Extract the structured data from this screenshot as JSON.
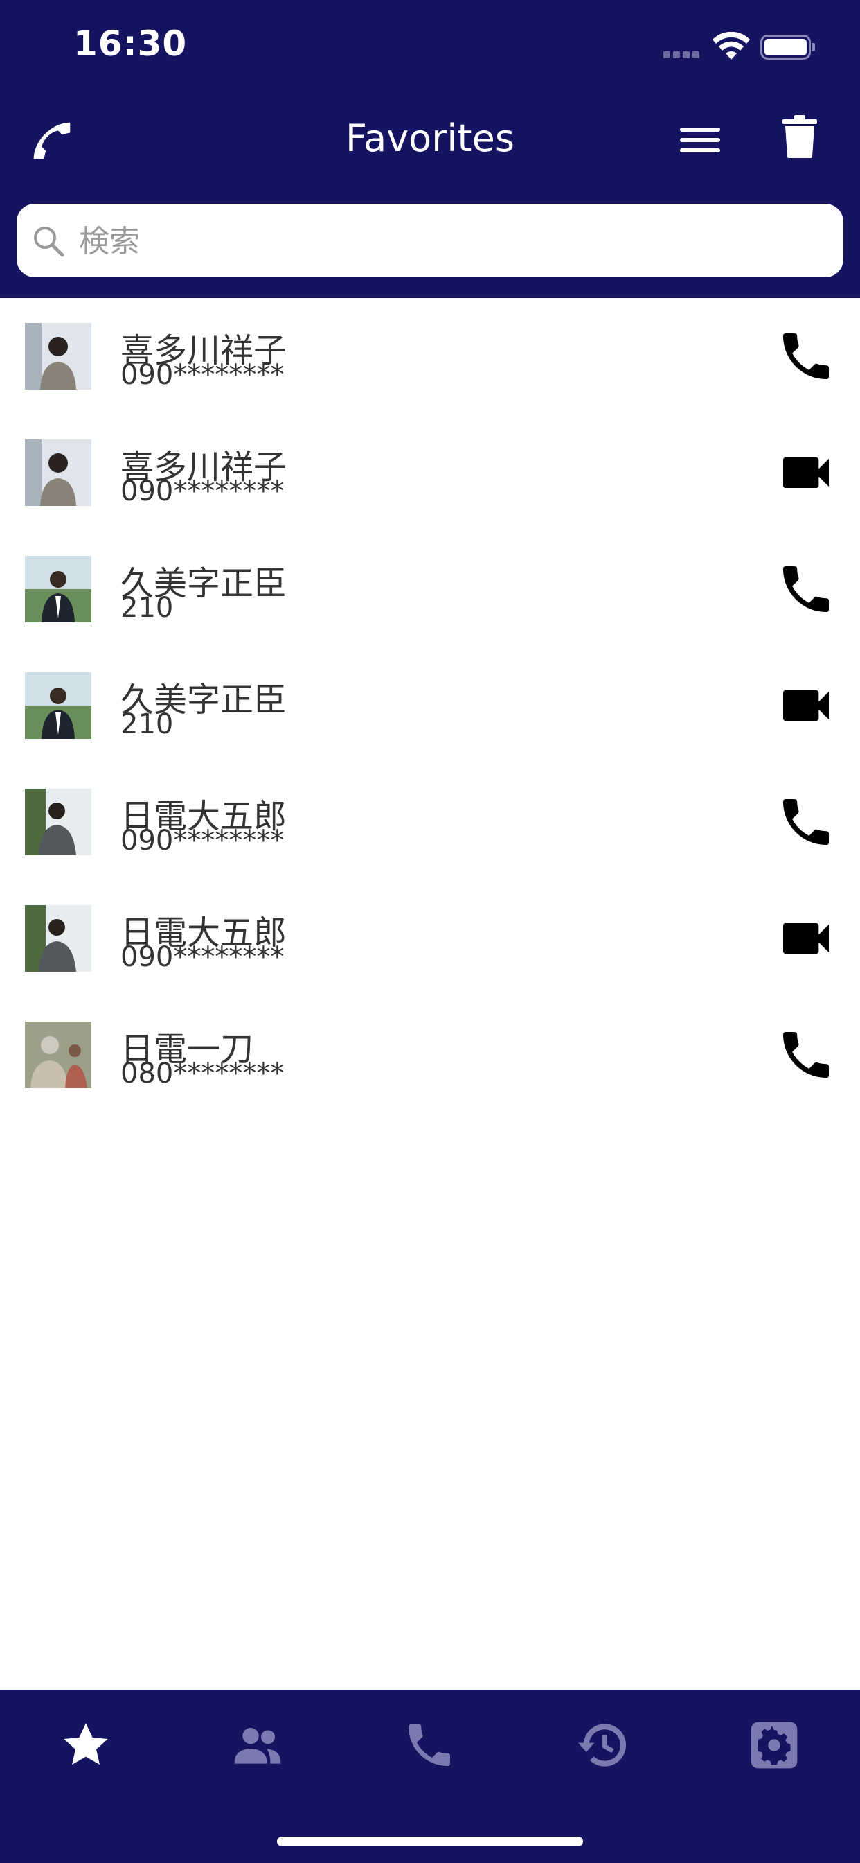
{
  "status_bar": {
    "time": "16:30",
    "icons": [
      "signal-icon",
      "wifi-icon",
      "battery-icon"
    ]
  },
  "nav": {
    "title": "Favorites",
    "left_icon": "phone-handset-icon",
    "right_icons": [
      "menu-icon",
      "trash-icon"
    ]
  },
  "search": {
    "placeholder": "検索",
    "value": ""
  },
  "favorites": [
    {
      "name": "喜多川祥子",
      "number": "090********",
      "action": "phone-icon"
    },
    {
      "name": "喜多川祥子",
      "number": "090********",
      "action": "video-icon"
    },
    {
      "name": "久美字正臣",
      "number": "210",
      "action": "phone-icon"
    },
    {
      "name": "久美字正臣",
      "number": "210",
      "action": "video-icon"
    },
    {
      "name": "日電大五郎",
      "number": "090********",
      "action": "phone-icon"
    },
    {
      "name": "日電大五郎",
      "number": "090********",
      "action": "video-icon"
    },
    {
      "name": "日電一刀",
      "number": "080********",
      "action": "phone-icon"
    }
  ],
  "tab_bar": {
    "tabs": [
      {
        "icon": "star-icon",
        "active": true
      },
      {
        "icon": "contacts-icon",
        "active": false
      },
      {
        "icon": "phone-icon",
        "active": false
      },
      {
        "icon": "history-icon",
        "active": false
      },
      {
        "icon": "settings-icon",
        "active": false
      }
    ]
  },
  "colors": {
    "bar": "#141460",
    "active_tab": "#ffffff",
    "inactive_tab": "#7a7ab0"
  }
}
